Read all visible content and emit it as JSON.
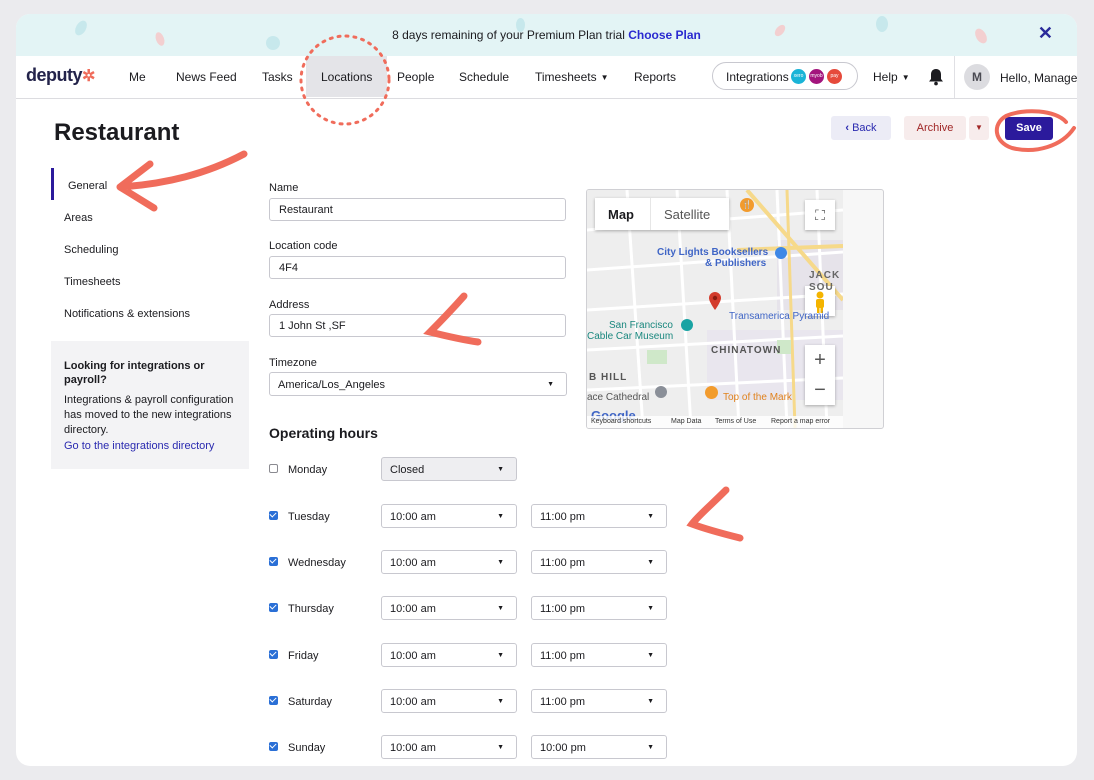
{
  "banner": {
    "text": "8 days remaining of your Premium Plan trial",
    "link": "Choose Plan",
    "close": "✕"
  },
  "nav": {
    "logo": "deputy",
    "items": [
      "Me",
      "News Feed",
      "Tasks",
      "Locations",
      "People",
      "Schedule",
      "Timesheets",
      "Reports"
    ],
    "active": "Locations",
    "integrations": {
      "label": "Integrations",
      "badges": [
        "xero",
        "myob",
        "pay"
      ]
    },
    "help": "Help",
    "avatar": "M",
    "hello": "Hello, Manager"
  },
  "page": {
    "title": "Restaurant",
    "back": "Back",
    "archive": "Archive",
    "save": "Save"
  },
  "sidebar": {
    "items": [
      "General",
      "Areas",
      "Scheduling",
      "Timesheets",
      "Notifications & extensions"
    ],
    "active": "General",
    "info": {
      "heading": "Looking for integrations or payroll?",
      "body": "Integrations & payroll configuration has moved to the new integrations directory.",
      "link": "Go to the integrations directory"
    }
  },
  "form": {
    "name_label": "Name",
    "name_value": "Restaurant",
    "code_label": "Location code",
    "code_value": "4F4",
    "address_label": "Address",
    "address_value": "1 John St ,SF",
    "timezone_label": "Timezone",
    "timezone_value": "America/Los_Angeles"
  },
  "hours": {
    "title": "Operating hours",
    "days": [
      {
        "day": "Monday",
        "checked": false,
        "closed": "Closed"
      },
      {
        "day": "Tuesday",
        "checked": true,
        "open": "10:00 am",
        "close": "11:00 pm"
      },
      {
        "day": "Wednesday",
        "checked": true,
        "open": "10:00 am",
        "close": "11:00 pm"
      },
      {
        "day": "Thursday",
        "checked": true,
        "open": "10:00 am",
        "close": "11:00 pm"
      },
      {
        "day": "Friday",
        "checked": true,
        "open": "10:00 am",
        "close": "11:00 pm"
      },
      {
        "day": "Saturday",
        "checked": true,
        "open": "10:00 am",
        "close": "11:00 pm"
      },
      {
        "day": "Sunday",
        "checked": true,
        "open": "10:00 am",
        "close": "10:00 pm"
      }
    ]
  },
  "map": {
    "tab_map": "Map",
    "tab_satellite": "Satellite",
    "labels": {
      "books": "City Lights Booksellers",
      "books2": "& Publishers",
      "museum": "San Francisco",
      "museum2": "Cable Car Museum",
      "transamerica": "Transamerica Pyramid",
      "chinatown": "CHINATOWN",
      "nobhill": "B HILL",
      "cathedral": "ace Cathedral",
      "topmark": "Top of the Mark",
      "jackson": "JACK",
      "sou": "SOU",
      "google": "Google"
    },
    "footer": [
      "Keyboard shortcuts",
      "Map Data",
      "Terms of Use",
      "Report a map error"
    ]
  },
  "colors": {
    "accent": "#2b1a9c",
    "annotation": "#f06c5b",
    "banner_bg": "#e3f4f5"
  }
}
